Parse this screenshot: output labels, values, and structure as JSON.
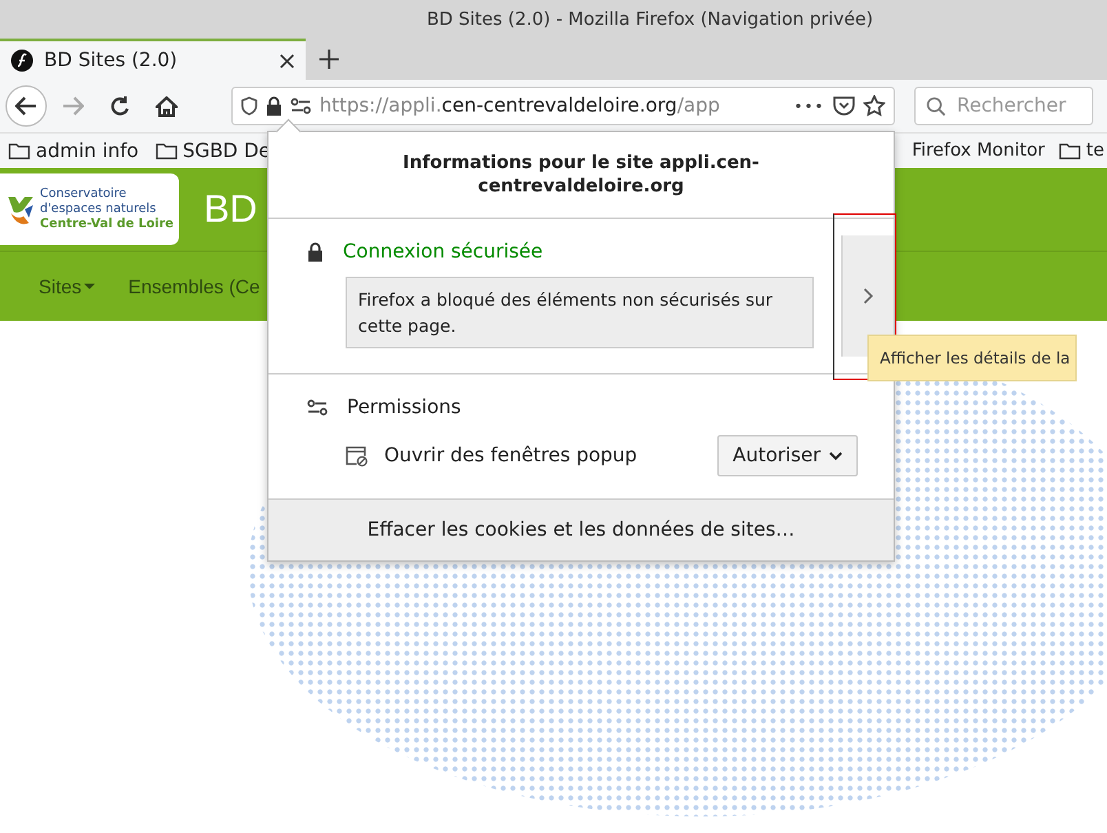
{
  "window": {
    "title": "BD Sites (2.0) - Mozilla Firefox (Navigation privée)"
  },
  "tabs": [
    {
      "title": "BD Sites (2.0)",
      "selected": true
    }
  ],
  "nav_buttons": [
    {
      "kind": "back",
      "disabled": false
    },
    {
      "kind": "forward",
      "disabled": true
    },
    {
      "kind": "reload",
      "disabled": false
    },
    {
      "kind": "home",
      "disabled": false
    }
  ],
  "url": [
    {
      "text": "https://appli.",
      "kind": "dim"
    },
    {
      "text": "cen-centrevaldeloire.org",
      "kind": "host"
    },
    {
      "text": "/app",
      "kind": "dim"
    }
  ],
  "url_more": "•••",
  "search": {
    "placeholder": "Rechercher"
  },
  "bookmarks_left": [
    "admin info",
    "SGBD De"
  ],
  "bookmarks_right": [
    {
      "label": "Firefox Monitor",
      "kind": "plain"
    },
    {
      "label": "te",
      "kind": "folder"
    }
  ],
  "site": {
    "logo_lines": [
      "Conservatoire",
      "d'espaces naturels",
      "Centre-Val de Loire"
    ],
    "title": "BD",
    "menu": [
      {
        "label": "Sites",
        "dropdown": true
      },
      {
        "label": "Ensembles (Ce",
        "dropdown": false
      }
    ]
  },
  "popup": {
    "title": "Informations pour le site appli.cen-centrevaldeloire.org",
    "connection": "Connexion sécurisée",
    "warning": "Firefox a bloqué des éléments non sécurisés sur cette page.",
    "permissions_heading": "Permissions",
    "permissions": [
      {
        "label": "Ouvrir des fenêtres popup",
        "value": "Autoriser"
      }
    ],
    "footer": "Effacer les cookies et les données de sites…"
  },
  "tooltip": "Afficher les détails de la"
}
